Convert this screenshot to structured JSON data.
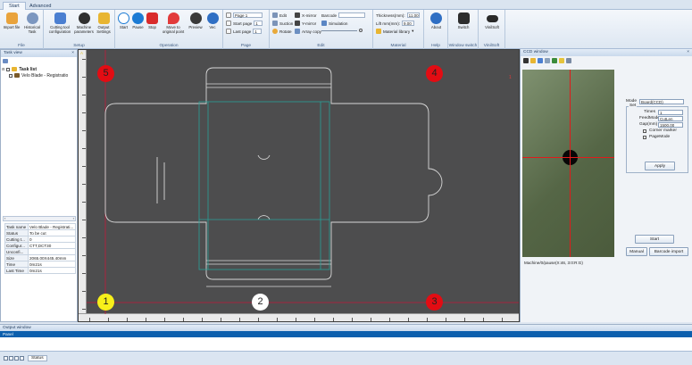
{
  "ribbon_tabs": [
    "Start",
    "Advanced"
  ],
  "groups": {
    "file": {
      "label": "File",
      "buttons": [
        "Import file",
        "Historical Task"
      ]
    },
    "setup": {
      "label": "Setup",
      "buttons": [
        "Cutting tool configuration",
        "Machine parameters",
        "Output Settings"
      ]
    },
    "operation": {
      "label": "Operation",
      "buttons": [
        "Start",
        "Pause",
        "Stop",
        "Move to original point",
        "Preview",
        "Vec"
      ]
    },
    "page": {
      "label": "Page",
      "page": "Page 1",
      "start_page": "Start page",
      "start_value": "1",
      "last_page": "Last page",
      "last_value": "1"
    },
    "edit": {
      "label": "Edit",
      "items": [
        "Edit",
        "X-mirror",
        "Barcode",
        "Suction",
        "Y-mirror",
        "Simulation",
        "Rotate",
        "Array copy"
      ]
    },
    "material": {
      "label": "Material",
      "thickness_label": "Thickness(mm):",
      "thickness_value": "11.00",
      "lift_label": "Lift mm(mm):",
      "lift_value": "9.00",
      "library": "Material library"
    },
    "help": {
      "label": "Help",
      "button": "About"
    },
    "window_switch": {
      "label": "Window switch",
      "button": "Switch"
    },
    "vinisoft": {
      "label": "VinilSoft",
      "button": "VinilSoft"
    }
  },
  "task_view": {
    "title": "Task view",
    "close": "×",
    "tree": [
      {
        "label": "Task list"
      },
      {
        "label": "Velo Blade - Registratio"
      }
    ],
    "props": [
      {
        "k": "Task name",
        "v": "Velo Blade - Registrati..."
      },
      {
        "k": "Status",
        "v": "To be cut"
      },
      {
        "k": "Cutting t...",
        "v": "0"
      },
      {
        "k": "Configur...",
        "v": "CTT,DCT30"
      },
      {
        "k": "Unconfi...",
        "v": ""
      },
      {
        "k": "Size",
        "v": "2065.00X445.40mm"
      },
      {
        "k": "Time",
        "v": "0m21s"
      },
      {
        "k": "Last Time",
        "v": "0m21s"
      }
    ]
  },
  "canvas": {
    "origin": "A",
    "markers": [
      "5",
      "4",
      "1",
      "2",
      "3"
    ],
    "corner_mark": "1"
  },
  "ccd": {
    "title": "CCD window",
    "close": "×",
    "mode_label": "Mode",
    "mode_value": "Board(CCD)",
    "set_label": "Set",
    "times_label": "Times",
    "times_value": "1",
    "feed_label": "FeedMode",
    "feed_value": "CutLen",
    "gap_label": "Gap(mm)",
    "gap_value": "1500.00",
    "corner_marker": "Corner marker",
    "page_mode": "PageMode",
    "apply": "Apply",
    "start": "Start",
    "manual": "Manual",
    "barcode_import": "Barcode import",
    "machine_status": "Machine/0/pause(X:46, 3:0:R:G)"
  },
  "output": {
    "title": "Output window",
    "header": "Panel"
  },
  "status_tab": "Status",
  "colors": {
    "accent": "#0c5fad",
    "marker_red": "#e30c13",
    "marker_yellow": "#f8ef1a",
    "canvas": "#4d4d4e",
    "guide": "#c2183a",
    "teal": "#2aa198"
  }
}
